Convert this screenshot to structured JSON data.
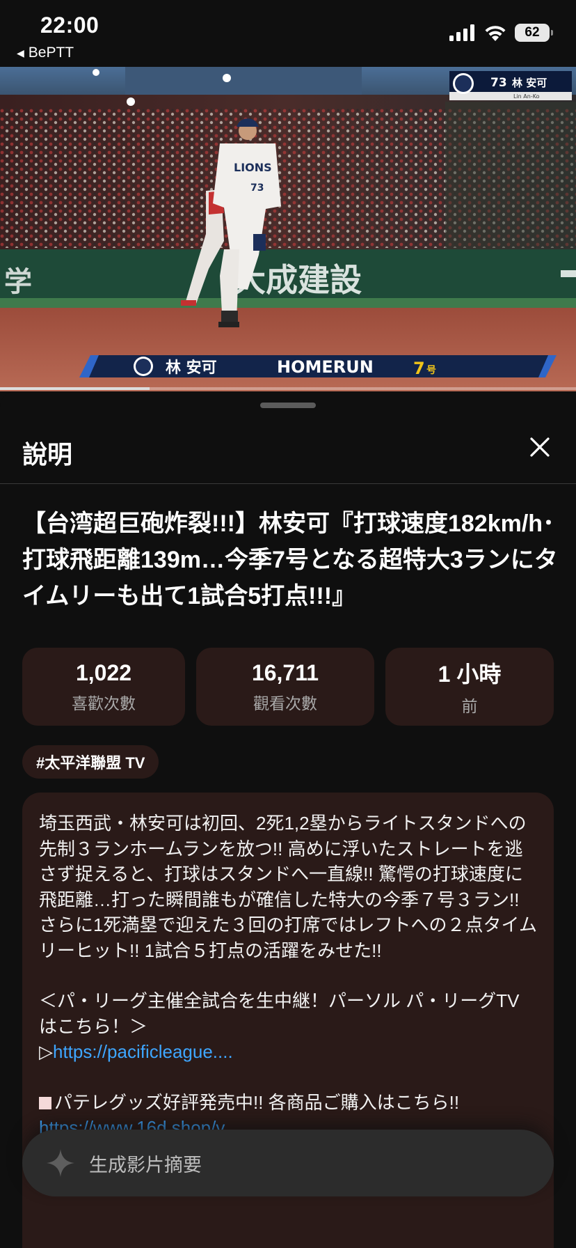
{
  "status_bar": {
    "time": "22:00",
    "back_app": "BePTT",
    "battery": "62"
  },
  "video": {
    "bug_number": "73",
    "bug_name": "林 安可",
    "bug_sub": "Lin An-Ko",
    "banner_name": "林 安可",
    "banner_event": "HOMERUN",
    "banner_count": "7",
    "banner_count_unit": "号",
    "wall_text_left": "学",
    "wall_text": "大成建設",
    "jersey_number": "73",
    "progress_fraction": 0.26
  },
  "sheet": {
    "title": "說明",
    "video_title": "【台湾超巨砲炸裂!!!】林安可『打球速度182km/h･打球飛距離139m…今季7号となる超特大3ランにタイムリーも出て1試合5打点!!!』",
    "stats": [
      {
        "value": "1,022",
        "label": "喜歡次數"
      },
      {
        "value": "16,711",
        "label": "觀看次數"
      },
      {
        "value": "1 小時",
        "label": "前"
      }
    ],
    "tag": "#太平洋聯盟 TV",
    "description": {
      "paragraph1": "埼玉西武・林安可は初回、2死1,2塁からライトスタンドへの先制３ランホームランを放つ!! 高めに浮いたストレートを逃さず捉えると、打球はスタンドへ一直線!! 驚愕の打球速度に飛距離…打った瞬間誰もが確信した特大の今季７号３ラン!! さらに1死満塁で迎えた３回の打席ではレフトへの２点タイムリーヒット!! 1試合５打点の活躍をみせた!!",
      "paragraph2": "＜パ・リーグ主催全試合を生中継！パーソル パ・リーグTVはこちら！＞",
      "link1_prefix": "▷",
      "link1": "https://pacificleague....",
      "paragraph3": "パテレグッズ好評発売中!! 各商品ご購入はこちら!!",
      "link2": "https://www.16d.shop/v..."
    },
    "summary_button": "生成影片摘要"
  },
  "icons": {
    "back": "back-triangle-icon",
    "signal": "cellular-signal-icon",
    "wifi": "wifi-icon",
    "battery": "battery-icon",
    "close": "close-icon",
    "sparkle": "sparkle-icon",
    "team_logo": "lions-logo-icon"
  },
  "colors": {
    "background": "#0f0f0f",
    "card": "#2a1a18",
    "link": "#3ea6ff",
    "banner_navy": "#12244a",
    "banner_accent": "#2f66c8",
    "count_yellow": "#f0c419"
  }
}
